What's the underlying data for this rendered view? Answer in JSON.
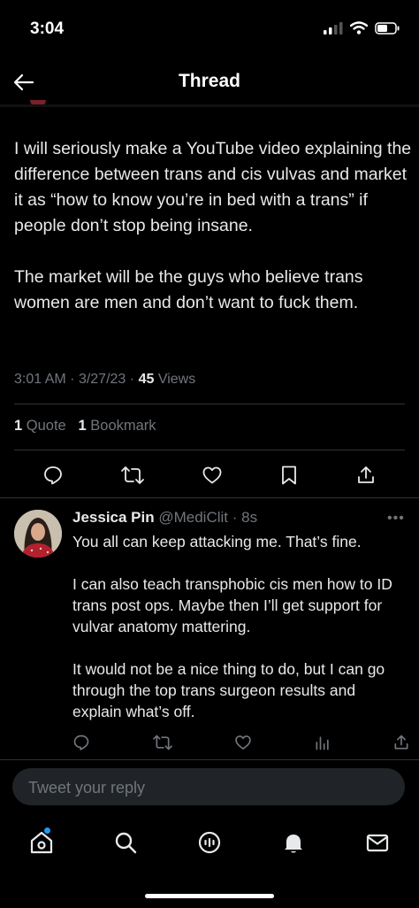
{
  "status_bar": {
    "time": "3:04"
  },
  "header": {
    "title": "Thread"
  },
  "tweet": {
    "text": "I will seriously make a YouTube video explaining the difference between trans and cis vulvas and market it as “how to know you’re in bed with a trans” if people don’t stop being insane.\n\nThe market will be the guys who believe trans women are men and don’t want to fuck them.",
    "time": "3:01 AM",
    "date": "3/27/23",
    "views_count": "45",
    "views_label": "Views",
    "quote_count": "1",
    "quote_label": "Quote",
    "bookmark_count": "1",
    "bookmark_label": "Bookmark"
  },
  "reply": {
    "name": "Jessica Pin",
    "handle": "@MediClit",
    "time": "8s",
    "text": "You all can keep attacking me. That’s fine.\n\nI can also teach transphobic cis men how to ID trans post ops. Maybe then I’ll get support for vulvar anatomy mattering.\n\nIt would not be a nice thing to do, but I can go through the top trans surgeon results and explain what’s off."
  },
  "composer": {
    "placeholder": "Tweet your reply"
  },
  "tabs": [
    "home-icon",
    "search-icon",
    "spaces-icon",
    "notifications-icon",
    "messages-icon"
  ],
  "colors": {
    "background": "#000000",
    "text": "#e7e9ea",
    "secondary": "#71767b",
    "accent": "#1d9bf0"
  }
}
